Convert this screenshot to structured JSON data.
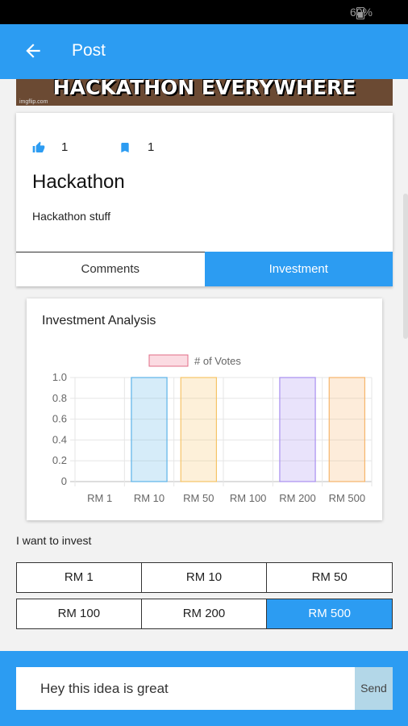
{
  "status_bar": {
    "battery": "60%"
  },
  "app_bar": {
    "title": "Post",
    "back_icon": "arrow-left-icon"
  },
  "banner": {
    "caption": "HACKATHON EVERYWHERE",
    "watermark": "imgflip.com"
  },
  "post": {
    "likes": "1",
    "bookmarks": "1",
    "title": "Hackathon",
    "description": "Hackathon stuff"
  },
  "tabs": [
    {
      "label": "Comments",
      "active": false
    },
    {
      "label": "Investment",
      "active": true
    }
  ],
  "chart_data": {
    "type": "bar",
    "title": "Investment Analysis",
    "categories": [
      "RM 1",
      "RM 10",
      "RM 50",
      "RM 100",
      "RM 200",
      "RM 500"
    ],
    "series": [
      {
        "name": "# of Votes",
        "values": [
          0,
          1,
          1,
          0,
          1,
          1
        ]
      }
    ],
    "ylim": [
      0,
      1.0
    ],
    "yticks": [
      "0",
      "0.2",
      "0.4",
      "0.6",
      "0.8",
      "1.0"
    ],
    "legend_position": "top",
    "bar_colors": [
      "#f4a5b6",
      "#5db3e8",
      "#f6c466",
      "#82cccc",
      "#a98ff0",
      "#f6b56b"
    ],
    "legend_color": "#f4a5b6"
  },
  "invest": {
    "label": "I want to invest",
    "options": [
      "RM 1",
      "RM 10",
      "RM 50",
      "RM 100",
      "RM 200",
      "RM 500"
    ],
    "selected": "RM 500"
  },
  "comment_box": {
    "value": "Hey this idea is great",
    "send_label": "Send"
  },
  "colors": {
    "primary": "#2c9cf2",
    "send_bg": "#b3d7e8"
  }
}
